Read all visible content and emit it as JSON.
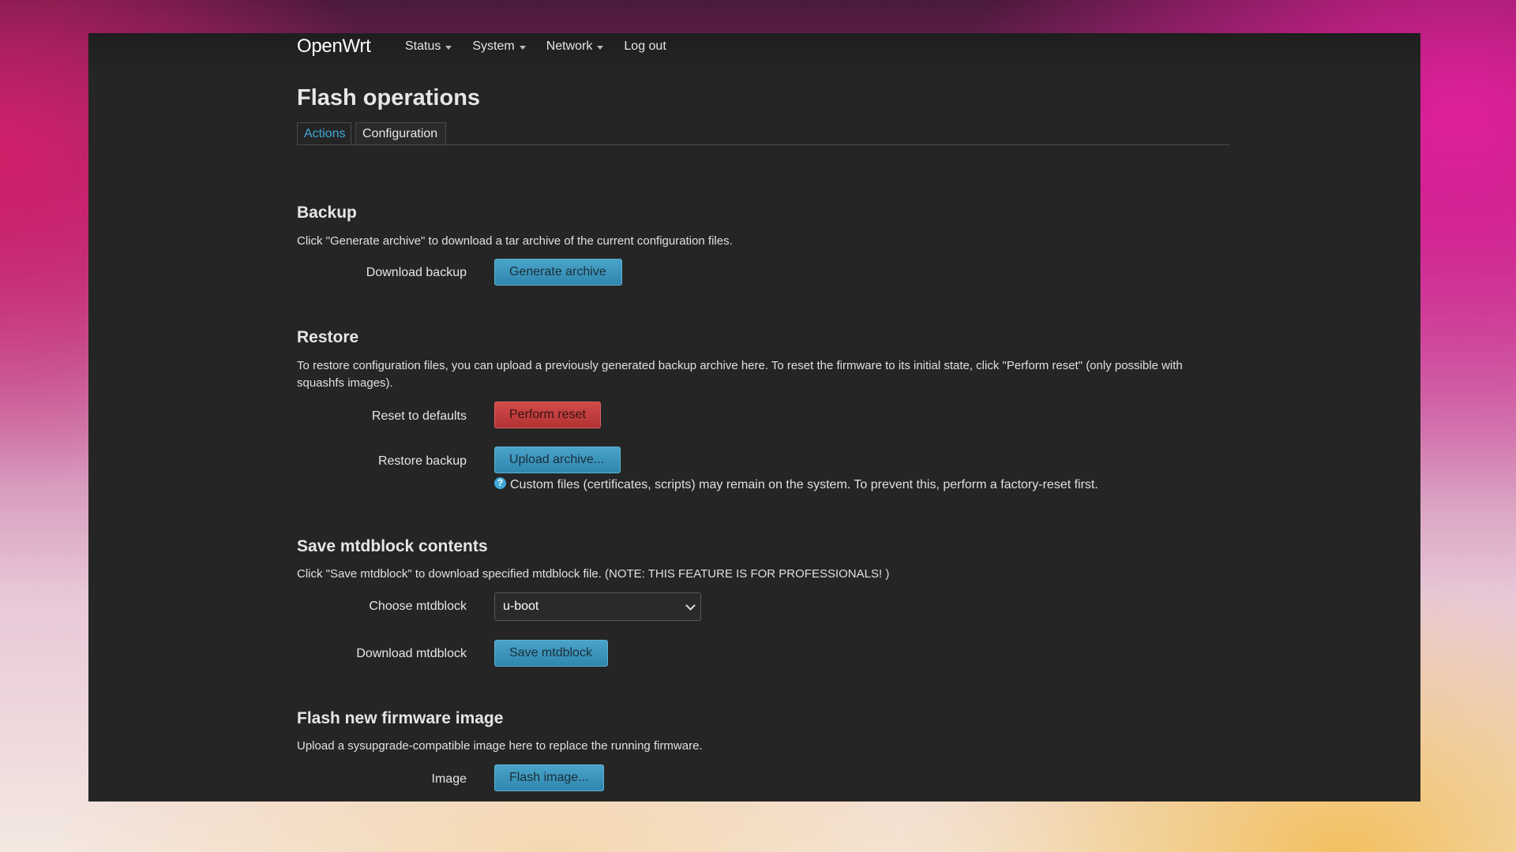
{
  "header": {
    "brand": "OpenWrt",
    "nav": [
      {
        "label": "Status",
        "dropdown": true
      },
      {
        "label": "System",
        "dropdown": true
      },
      {
        "label": "Network",
        "dropdown": true
      },
      {
        "label": "Log out",
        "dropdown": false
      }
    ]
  },
  "page": {
    "title": "Flash operations",
    "tabs": [
      {
        "label": "Actions",
        "active": true
      },
      {
        "label": "Configuration",
        "active": false
      }
    ]
  },
  "backup": {
    "title": "Backup",
    "description": "Click \"Generate archive\" to download a tar archive of the current configuration files.",
    "download_label": "Download backup",
    "generate_button": "Generate archive"
  },
  "restore": {
    "title": "Restore",
    "description": "To restore configuration files, you can upload a previously generated backup archive here. To reset the firmware to its initial state, click \"Perform reset\" (only possible with squashfs images).",
    "reset_label": "Reset to defaults",
    "reset_button": "Perform reset",
    "restore_label": "Restore backup",
    "upload_button": "Upload archive...",
    "hint_icon": "question-circle-icon",
    "hint": "Custom files (certificates, scripts) may remain on the system. To prevent this, perform a factory-reset first."
  },
  "mtdblock": {
    "title": "Save mtdblock contents",
    "description": "Click \"Save mtdblock\" to download specified mtdblock file. (NOTE: THIS FEATURE IS FOR PROFESSIONALS! )",
    "choose_label": "Choose mtdblock",
    "selected": "u-boot",
    "download_label": "Download mtdblock",
    "save_button": "Save mtdblock"
  },
  "firmware": {
    "title": "Flash new firmware image",
    "description": "Upload a sysupgrade-compatible image here to replace the running firmware.",
    "image_label": "Image",
    "flash_button": "Flash image..."
  },
  "colors": {
    "accent": "#3fa9d8",
    "danger": "#c53f3f",
    "panel_bg": "#252525"
  }
}
